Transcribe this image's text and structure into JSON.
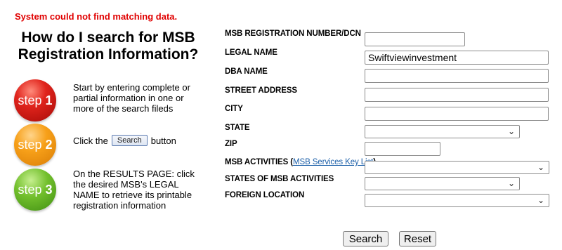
{
  "error": "System could not find matching data.",
  "help": {
    "title": "How do I search for MSB Registration Information?",
    "step1": {
      "word": "step",
      "num": "1",
      "text": "Start by entering complete or partial information in one or more of the search fileds"
    },
    "step2": {
      "word": "step",
      "num": "2",
      "text_before": "Click the",
      "button": "Search",
      "text_after": "button"
    },
    "step3": {
      "word": "step",
      "num": "3",
      "text": "On the RESULTS PAGE: click the desired MSB's LEGAL NAME to retrieve its printable registration information"
    }
  },
  "form": {
    "reg_number": {
      "label": "MSB REGISTRATION NUMBER/DCN",
      "value": ""
    },
    "legal_name": {
      "label": "LEGAL NAME",
      "value": "Swiftviewinvestment"
    },
    "dba_name": {
      "label": "DBA NAME",
      "value": ""
    },
    "street": {
      "label": "STREET ADDRESS",
      "value": ""
    },
    "city": {
      "label": "CITY",
      "value": ""
    },
    "state": {
      "label": "STATE",
      "value": ""
    },
    "zip": {
      "label": "ZIP",
      "value": ""
    },
    "activities": {
      "label": "MSB ACTIVITIES (",
      "link": "MSB Services Key List",
      "close": ")",
      "value": ""
    },
    "states_of_activities": {
      "label": "STATES OF MSB ACTIVITIES",
      "value": ""
    },
    "foreign_location": {
      "label": "FOREIGN LOCATION",
      "value": ""
    },
    "search_button": "Search",
    "reset_button": "Reset"
  },
  "icons": {
    "select_arrow": "chevron-down-icon"
  },
  "colors": {
    "error": "#e00000",
    "link": "#1a5ea8",
    "step1": "#e0241c",
    "step2": "#f7a019",
    "step3": "#72bf2c"
  }
}
